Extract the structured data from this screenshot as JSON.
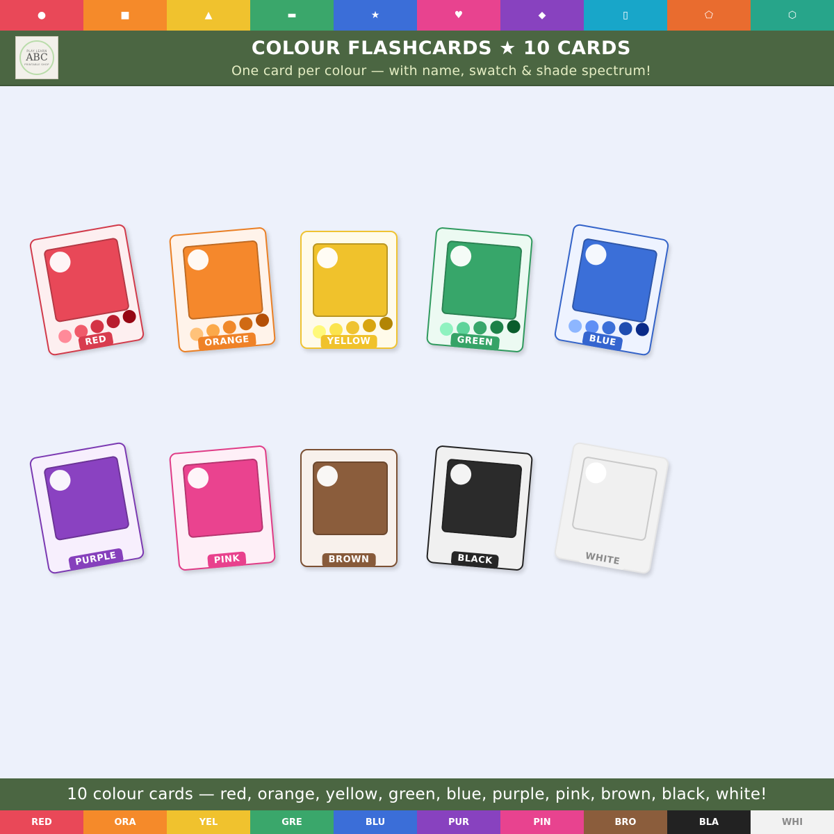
{
  "top_strip": [
    {
      "icon": "●",
      "icon_name": "circle-icon",
      "color": "#e94858"
    },
    {
      "icon": "■",
      "icon_name": "square-icon",
      "color": "#f58a2a"
    },
    {
      "icon": "▲",
      "icon_name": "triangle-icon",
      "color": "#f0c22e"
    },
    {
      "icon": "▬",
      "icon_name": "rectangle-icon",
      "color": "#3aa76b"
    },
    {
      "icon": "★",
      "icon_name": "star-icon",
      "color": "#3b6ed8"
    },
    {
      "icon": "♥",
      "icon_name": "heart-icon",
      "color": "#e8438f"
    },
    {
      "icon": "◆",
      "icon_name": "diamond-icon",
      "color": "#8842bf"
    },
    {
      "icon": "▯",
      "icon_name": "oval-icon",
      "color": "#18a6c9"
    },
    {
      "icon": "⬠",
      "icon_name": "pentagon-icon",
      "color": "#e96c2f"
    },
    {
      "icon": "⬡",
      "icon_name": "hexagon-icon",
      "color": "#27a58a"
    }
  ],
  "header": {
    "logo": {
      "top_text": "PLAY LEARN",
      "main_text": "ABC",
      "bottom_text": "PRINTABLE SHOP"
    },
    "title": "COLOUR FLASHCARDS  ★  10 CARDS",
    "subtitle": "One card per colour — with name, swatch & shade spectrum!"
  },
  "cards": [
    {
      "label": "RED",
      "rotate": -10,
      "color": "#e84858",
      "bg": "#fdeff0",
      "border": "#d23a4a",
      "label_bg": "#d83c4e",
      "label_fg": "#ffffff",
      "shades": [
        "#ff8a99",
        "#f05a6a",
        "#d43445",
        "#b81d2e",
        "#960714"
      ]
    },
    {
      "label": "ORANGE",
      "rotate": -5,
      "color": "#f5882c",
      "bg": "#fff3ea",
      "border": "#ea7f24",
      "label_bg": "#ef8227",
      "label_fg": "#ffffff",
      "shades": [
        "#ffc27a",
        "#fba94a",
        "#f0882a",
        "#d06a14",
        "#b44f06"
      ]
    },
    {
      "label": "YELLOW",
      "rotate": 0,
      "color": "#f0c22c",
      "bg": "#fffbea",
      "border": "#efc332",
      "label_bg": "#f0c22c",
      "label_fg": "#ffffff",
      "shades": [
        "#fff97a",
        "#fbe44d",
        "#efc332",
        "#d8a50f",
        "#b28505"
      ]
    },
    {
      "label": "GREEN",
      "rotate": 5,
      "color": "#37a66a",
      "bg": "#ecfaf2",
      "border": "#2f9a5e",
      "label_bg": "#35a367",
      "label_fg": "#ffffff",
      "shades": [
        "#8ff2c0",
        "#5dd39a",
        "#37a66a",
        "#1d8148",
        "#0a5d2c"
      ]
    },
    {
      "label": "BLUE",
      "rotate": 10,
      "color": "#3b6fd8",
      "bg": "#eef3ff",
      "border": "#3363c9",
      "label_bg": "#3565cf",
      "label_fg": "#ffffff",
      "shades": [
        "#8db6ff",
        "#5f8ff5",
        "#3b6fd8",
        "#1f4db0",
        "#0a2a88"
      ]
    },
    {
      "label": "PURPLE",
      "rotate": -10,
      "color": "#8a42c1",
      "bg": "#f7effd",
      "border": "#7b39b2",
      "label_bg": "#8640bc",
      "label_fg": "#ffffff",
      "shades": []
    },
    {
      "label": "PINK",
      "rotate": -5,
      "color": "#ea438f",
      "bg": "#feeff7",
      "border": "#e03b86",
      "label_bg": "#e8418d",
      "label_fg": "#ffffff",
      "shades": []
    },
    {
      "label": "BROWN",
      "rotate": 0,
      "color": "#8b5d3c",
      "bg": "#f8f1ec",
      "border": "#7b5033",
      "label_bg": "#875a3a",
      "label_fg": "#ffffff",
      "shades": []
    },
    {
      "label": "BLACK",
      "rotate": 5,
      "color": "#2b2b2b",
      "bg": "#f0f0f0",
      "border": "#222222",
      "label_bg": "#262626",
      "label_fg": "#ffffff",
      "shades": []
    },
    {
      "label": "WHITE",
      "rotate": 10,
      "color": "#f0f0f0",
      "bg": "#f2f2f2",
      "border": "#e6e6e6",
      "label_bg": "#f2f2f2",
      "label_fg": "#8a8a8a",
      "shades": []
    }
  ],
  "footer": {
    "text": "10 colour cards — red, orange, yellow, green, blue, purple, pink, brown, black, white!"
  },
  "bottom_strip": [
    {
      "label": "RED",
      "color": "#e94858",
      "fg": "#ffffff"
    },
    {
      "label": "ORA",
      "color": "#f58a2a",
      "fg": "#ffffff"
    },
    {
      "label": "YEL",
      "color": "#f0c22e",
      "fg": "#ffffff"
    },
    {
      "label": "GRE",
      "color": "#3aa76b",
      "fg": "#ffffff"
    },
    {
      "label": "BLU",
      "color": "#3b6ed8",
      "fg": "#ffffff"
    },
    {
      "label": "PUR",
      "color": "#8842bf",
      "fg": "#ffffff"
    },
    {
      "label": "PIN",
      "color": "#e8438f",
      "fg": "#ffffff"
    },
    {
      "label": "BRO",
      "color": "#8b5d3c",
      "fg": "#ffffff"
    },
    {
      "label": "BLA",
      "color": "#222222",
      "fg": "#ffffff"
    },
    {
      "label": "WHI",
      "color": "#f2f2f2",
      "fg": "#8a8a8a"
    }
  ]
}
